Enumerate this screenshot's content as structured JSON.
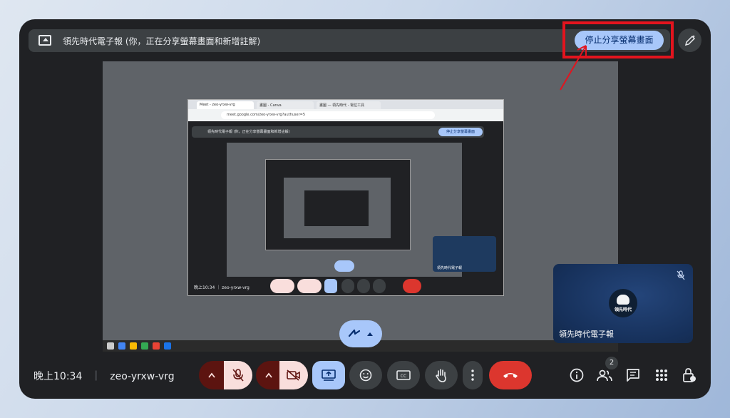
{
  "banner": {
    "text": "領先時代電子報 (你，正在分享螢幕畫面和新增註解)",
    "stop_label": "停止分享螢幕畫面"
  },
  "shared_screen": {
    "tabs": [
      "Meet - zeo-yrxw-vrg",
      "畫圖 - Canva",
      "畫圖 — 領先時代 - 電位工具"
    ],
    "url": "meet.google.com/zeo-yrxw-vrg?authuser=5",
    "banner_text": "領先時代電子報 (你，正在分享螢幕畫面和新增註解)",
    "stop_label": "停止分享螢幕畫面",
    "tile_name": "領先時代電子報",
    "time_label": "晚上10:34 ｜ zeo-yrxw-vrg"
  },
  "self_tile": {
    "name": "領先時代電子報",
    "avatar_text": "領先時代"
  },
  "bottom_bar": {
    "time": "晚上10:34",
    "separator": "｜",
    "meeting_code": "zeo-yrxw-vrg",
    "people_count": "2"
  },
  "colors": {
    "accent": "#a8c7fa",
    "end_call": "#dc362e",
    "highlight": "#e3141e"
  }
}
